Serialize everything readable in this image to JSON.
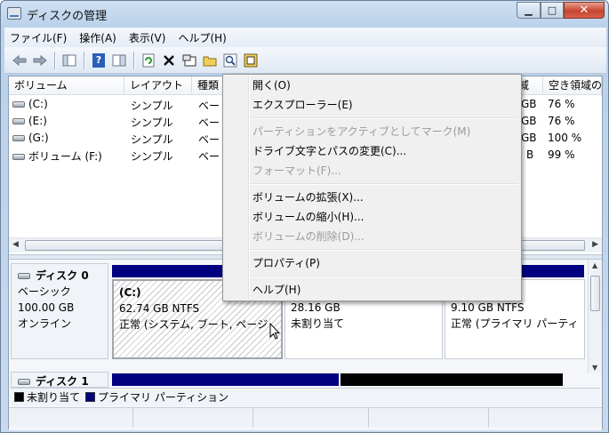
{
  "window": {
    "title": "ディスクの管理"
  },
  "menubar": {
    "items": [
      "ファイル(F)",
      "操作(A)",
      "表示(V)",
      "ヘルプ(H)"
    ]
  },
  "toolbar": {
    "icons": [
      "back-arrow-icon",
      "forward-arrow-icon",
      "console-tree-icon",
      "help-icon",
      "properties-pane-icon",
      "refresh-icon",
      "delete-icon",
      "properties-icon",
      "open-folder-icon",
      "search-icon",
      "settings-icon"
    ]
  },
  "volume_list": {
    "columns": [
      "ボリューム",
      "レイアウト",
      "種類",
      "域",
      "空き領域の"
    ],
    "rows": [
      {
        "name": "(C:)",
        "layout": "シンプル",
        "type": "ベー",
        "free": "GB",
        "pct": "76 %"
      },
      {
        "name": "(E:)",
        "layout": "シンプル",
        "type": "ベー",
        "free": "GB",
        "pct": "76 %"
      },
      {
        "name": "(G:)",
        "layout": "シンプル",
        "type": "ベー",
        "free": "GB",
        "pct": "100 %"
      },
      {
        "name": "ボリューム (F:)",
        "layout": "シンプル",
        "type": "ベー",
        "free": "B",
        "pct": "99 %"
      }
    ]
  },
  "disks": [
    {
      "name": "ディスク 0",
      "type": "ベーシック",
      "size": "100.00 GB",
      "status": "オンライン",
      "partitions": [
        {
          "title": "(C:)",
          "size": "62.74 GB NTFS",
          "status": "正常 (システム, ブート, ページ"
        },
        {
          "title": "",
          "size": "28.16 GB",
          "status": "未割り当て"
        },
        {
          "title": ":)",
          "size": "9.10 GB NTFS",
          "status": "正常 (プライマリ パーティ"
        }
      ]
    },
    {
      "name": "ディスク 1"
    }
  ],
  "legend": [
    {
      "label": "未割り当て",
      "color": "#000000"
    },
    {
      "label": "プライマリ パーティション",
      "color": "#000080"
    }
  ],
  "context_menu": {
    "items": [
      {
        "label": "開く(O)",
        "enabled": true
      },
      {
        "label": "エクスプローラー(E)",
        "enabled": true
      },
      {
        "label": "パーティションをアクティブとしてマーク(M)",
        "enabled": false
      },
      {
        "label": "ドライブ文字とパスの変更(C)...",
        "enabled": true
      },
      {
        "label": "フォーマット(F)...",
        "enabled": false
      },
      {
        "label": "ボリュームの拡張(X)...",
        "enabled": true
      },
      {
        "label": "ボリュームの縮小(H)...",
        "enabled": true
      },
      {
        "label": "ボリュームの削除(D)...",
        "enabled": false
      },
      {
        "label": "プロパティ(P)",
        "enabled": true
      },
      {
        "label": "ヘルプ(H)",
        "enabled": true
      }
    ]
  },
  "colors": {
    "primary_partition": "#000080",
    "unallocated": "#000000"
  }
}
